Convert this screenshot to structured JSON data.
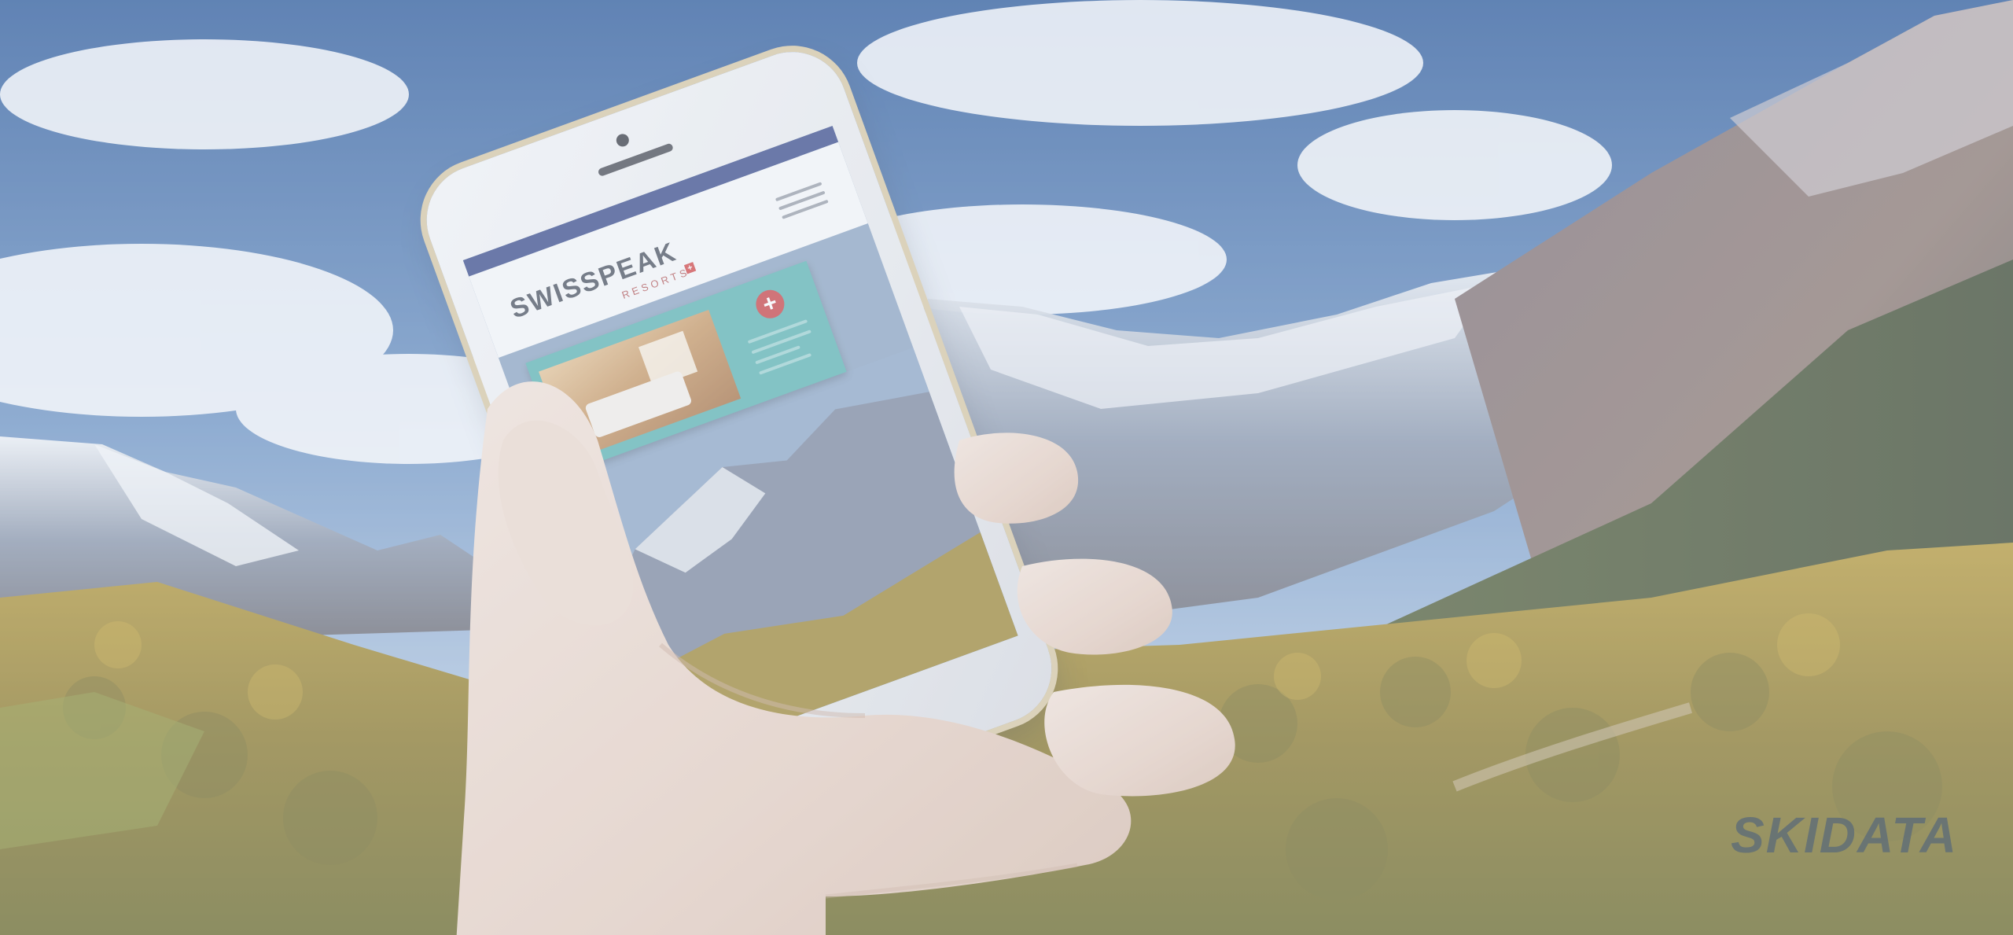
{
  "scene": {
    "description_colors": {
      "sky_top": "#2e5a9a",
      "sky_bottom": "#9db8d8",
      "forest": "#a38a2a",
      "mountain": "#7a6a70",
      "accent_teal": "#5fb4b3",
      "brand_navy": "#3d4e8c",
      "brand_red": "#c9474a"
    }
  },
  "phone_site": {
    "logo_main": "SWISSPEAK",
    "logo_sub": "RESORTS",
    "logo_flag": "+",
    "menu_icon": "hamburger-menu-icon",
    "promo_plus": "+"
  },
  "watermark": {
    "text": "SKIDATA"
  }
}
